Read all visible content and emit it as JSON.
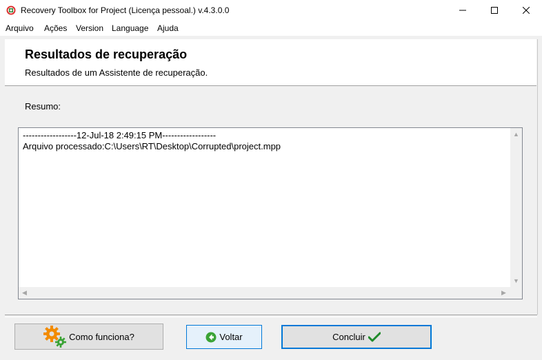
{
  "window": {
    "title": "Recovery Toolbox for Project (Licença pessoal.) v.4.3.0.0"
  },
  "menu": {
    "items": [
      "Arquivo",
      "Ações",
      "Version",
      "Language",
      "Ajuda"
    ]
  },
  "header": {
    "title": "Resultados de recuperação",
    "subtitle": "Resultados de um Assistente de recuperação."
  },
  "summary": {
    "label": "Resumo:",
    "log_lines": [
      "------------------12-Jul-18 2:49:15 PM------------------",
      "Arquivo processado:C:\\Users\\RT\\Desktop\\Corrupted\\project.mpp"
    ]
  },
  "buttons": {
    "help_label": "Como funciona?",
    "back_label": "Voltar",
    "finish_label": "Concluir"
  },
  "colors": {
    "accent": "#0078d7",
    "back_icon": "#3aa335",
    "finish_check": "#1f8a2a",
    "gear_orange": "#f28b00",
    "gear_green": "#3aa335"
  }
}
